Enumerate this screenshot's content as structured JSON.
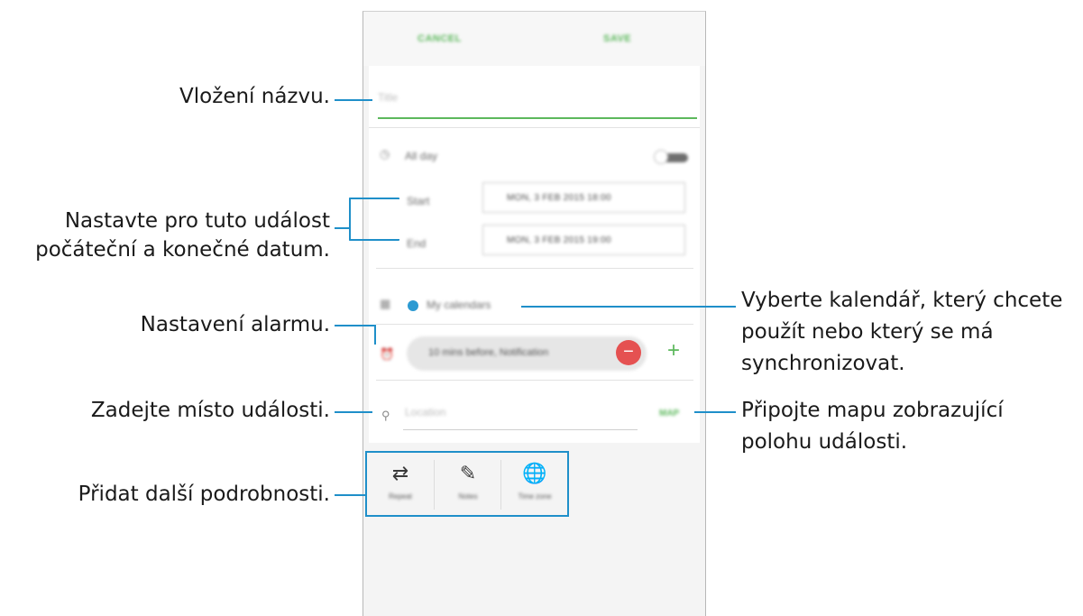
{
  "header": {
    "cancel_label": "CANCEL",
    "save_label": "SAVE"
  },
  "form": {
    "title_placeholder": "Title",
    "all_day_label": "All day",
    "start_label": "Start",
    "start_value": "MON, 3 FEB 2015   18:00",
    "end_label": "End",
    "end_value": "MON, 3 FEB 2015   19:00",
    "calendar_label": "My calendars",
    "alarm_value": "10 mins before, Notification",
    "location_placeholder": "Location",
    "map_label": "MAP"
  },
  "detail_buttons": [
    {
      "label": "Repeat",
      "icon": "repeat-icon"
    },
    {
      "label": "Notes",
      "icon": "notes-icon"
    },
    {
      "label": "Time zone",
      "icon": "timezone-icon"
    }
  ],
  "callouts": {
    "title": "Vložení názvu.",
    "dates_line1": "Nastavte pro tuto událost",
    "dates_line2": "počáteční a konečné datum.",
    "alarm": "Nastavení alarmu.",
    "location": "Zadejte místo události.",
    "details": "Přidat další podrobnosti.",
    "calendar_line1": "Vyberte kalendář, který chcete",
    "calendar_line2": "použít nebo který se má",
    "calendar_line3": "synchronizovat.",
    "map_line1": "Připojte mapu zobrazující",
    "map_line2": "polohu události."
  },
  "colors": {
    "accent_green": "#5cb85c",
    "callout_blue": "#1f8fc9",
    "minus_red": "#e55151",
    "calendar_blue": "#2c9ad2"
  }
}
